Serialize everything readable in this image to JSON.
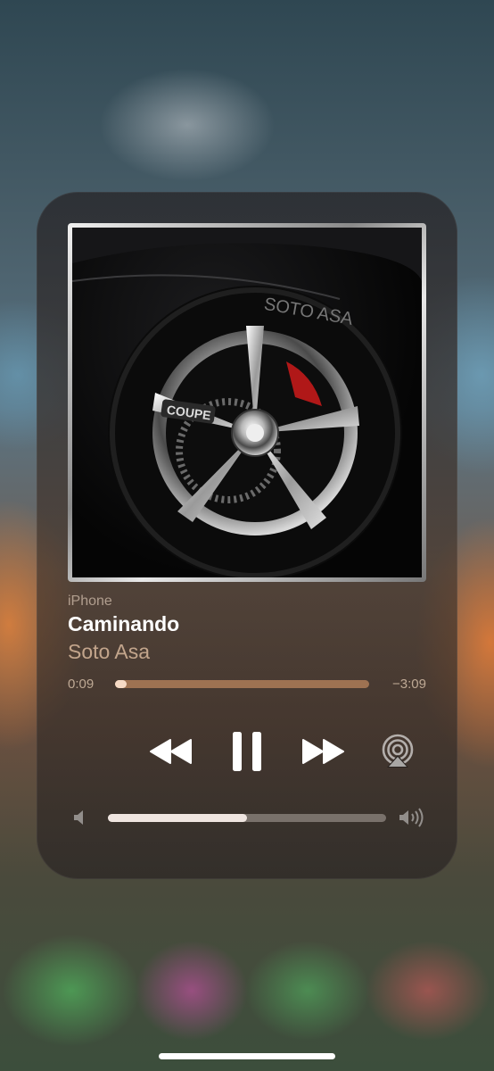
{
  "player": {
    "source": "iPhone",
    "track_title": "Caminando",
    "artist": "Soto Asa",
    "elapsed": "0:09",
    "remaining": "−3:09",
    "progress_fraction": 0.047,
    "volume_fraction": 0.5
  },
  "artwork": {
    "tire_text": "SOTO ASA",
    "wheel_badge": "COUPE"
  },
  "controls": {
    "rewind": "rewind-icon",
    "pause": "pause-icon",
    "forward": "fast-forward-icon",
    "airplay": "airplay-icon",
    "volume_low": "speaker-low-icon",
    "volume_high": "speaker-high-icon"
  },
  "colors": {
    "accent": "#ffffff",
    "artist_text": "#ebc8aa"
  }
}
